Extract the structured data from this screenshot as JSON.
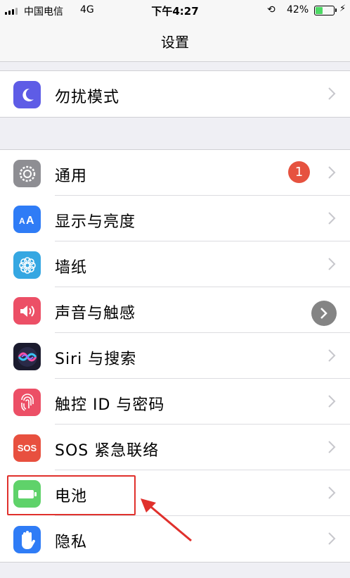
{
  "status_bar": {
    "carrier": "中国电信",
    "network": "4G",
    "time": "下午4:27",
    "battery_percent": "42%",
    "battery_level": 0.42
  },
  "nav": {
    "title": "设置"
  },
  "group1": [
    {
      "label": "勿扰模式",
      "icon": "moon-icon",
      "color": "#5e5ce6"
    }
  ],
  "group2": [
    {
      "label": "通用",
      "icon": "gear-icon",
      "color": "#8e8e93",
      "badge": "1"
    },
    {
      "label": "显示与亮度",
      "icon": "text-size-icon",
      "color": "#2f7cf6"
    },
    {
      "label": "墙纸",
      "icon": "flower-icon",
      "color": "#35a7e2"
    },
    {
      "label": "声音与触感",
      "icon": "speaker-icon",
      "color": "#ec4f66"
    },
    {
      "label": "Siri 与搜索",
      "icon": "siri-icon",
      "color": "#1b1b2e"
    },
    {
      "label": "触控 ID 与密码",
      "icon": "fingerprint-icon",
      "color": "#ec4f66"
    },
    {
      "label": "SOS 紧急联络",
      "icon": "sos-icon",
      "color": "#e8503f",
      "icon_text": "SOS"
    },
    {
      "label": "电池",
      "icon": "battery-icon",
      "color": "#5fd26a"
    },
    {
      "label": "隐私",
      "icon": "hand-icon",
      "color": "#2f7cf6"
    }
  ],
  "annotation": {
    "highlight_color": "#e0302c"
  }
}
